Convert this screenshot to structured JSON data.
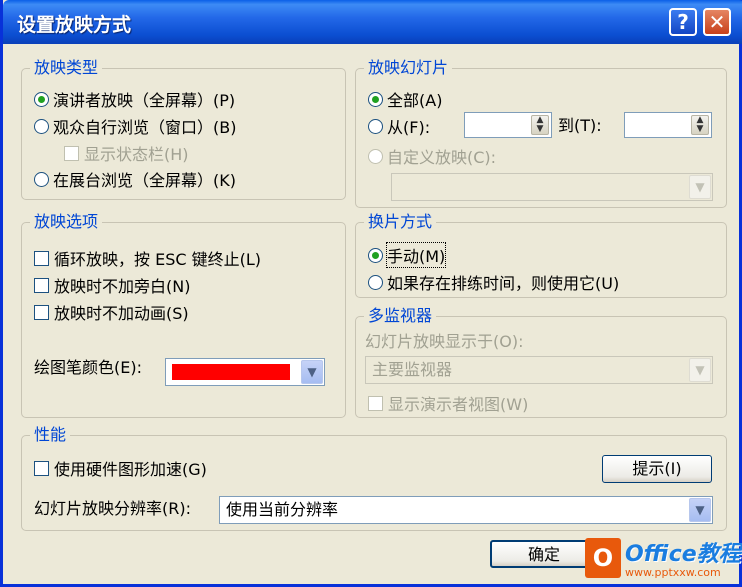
{
  "window": {
    "title": "设置放映方式"
  },
  "show_type": {
    "legend": "放映类型",
    "options": [
      {
        "label": "演讲者放映（全屏幕）(P)",
        "selected": true
      },
      {
        "label": "观众自行浏览（窗口）(B)",
        "selected": false
      },
      {
        "label": "在展台浏览（全屏幕）(K)",
        "selected": false
      }
    ],
    "status_bar": {
      "label": "显示状态栏(H)",
      "checked": false,
      "disabled": true
    }
  },
  "slides": {
    "legend": "放映幻灯片",
    "all_label": "全部(A)",
    "from_label": "从(F):",
    "to_label": "到(T):",
    "custom_label": "自定义放映(C):"
  },
  "show_options": {
    "legend": "放映选项",
    "items": [
      {
        "label": "循环放映，按 ESC 键终止(L)"
      },
      {
        "label": "放映时不加旁白(N)"
      },
      {
        "label": "放映时不加动画(S)"
      }
    ],
    "pen_color_label": "绘图笔颜色(E):",
    "pen_color": "#ff0000"
  },
  "advance": {
    "legend": "换片方式",
    "options": [
      {
        "label": "手动(M)",
        "selected": true
      },
      {
        "label": "如果存在排练时间，则使用它(U)",
        "selected": false
      }
    ]
  },
  "multi_monitor": {
    "legend": "多监视器",
    "display_on_label": "幻灯片放映显示于(O):",
    "display_on_value": "主要监视器",
    "presenter_view_label": "显示演示者视图(W)"
  },
  "performance": {
    "legend": "性能",
    "hw_accel_label": "使用硬件图形加速(G)",
    "tips_button": "提示(I)",
    "resolution_label": "幻灯片放映分辨率(R):",
    "resolution_value": "使用当前分辨率"
  },
  "footer": {
    "ok_button": "确定"
  },
  "watermark": {
    "brand": "Office教程网",
    "url": "www.pptxxw.com"
  }
}
